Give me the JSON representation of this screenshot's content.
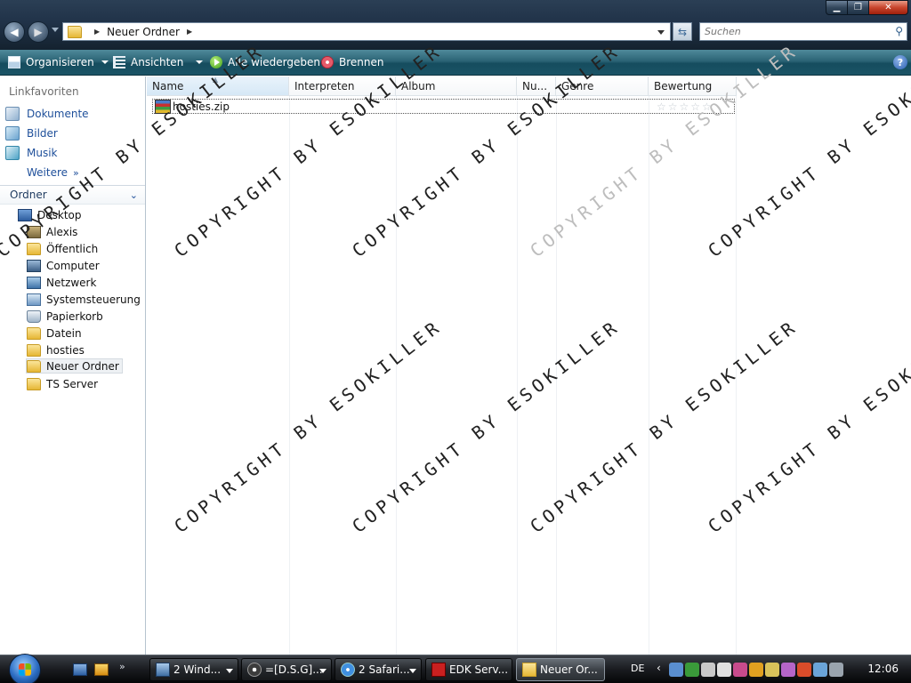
{
  "window": {
    "address_crumb": "Neuer Ordner",
    "search_placeholder": "Suchen"
  },
  "toolbar": {
    "organize": "Organisieren",
    "views": "Ansichten",
    "play_all": "Alle wiedergeben",
    "burn": "Brennen",
    "help_glyph": "?"
  },
  "nav": {
    "favorites_heading": "Linkfavoriten",
    "favorites": [
      {
        "label": "Dokumente",
        "icon": "documents-icon"
      },
      {
        "label": "Bilder",
        "icon": "pictures-icon"
      },
      {
        "label": "Musik",
        "icon": "music-icon"
      }
    ],
    "more_label": "Weitere",
    "folders_heading": "Ordner",
    "tree": [
      {
        "label": "Desktop",
        "icon": "desktop-icon"
      },
      {
        "label": "Alexis",
        "icon": "user-folder-icon"
      },
      {
        "label": "Öffentlich",
        "icon": "folder-icon"
      },
      {
        "label": "Computer",
        "icon": "computer-icon"
      },
      {
        "label": "Netzwerk",
        "icon": "network-icon"
      },
      {
        "label": "Systemsteuerung",
        "icon": "control-panel-icon"
      },
      {
        "label": "Papierkorb",
        "icon": "recycle-bin-icon"
      },
      {
        "label": "Datein",
        "icon": "folder-icon"
      },
      {
        "label": "hosties",
        "icon": "folder-icon"
      },
      {
        "label": "Neuer Ordner",
        "icon": "folder-icon",
        "selected": true
      },
      {
        "label": "TS Server",
        "icon": "folder-icon"
      }
    ]
  },
  "list": {
    "columns": [
      "Name",
      "Interpreten",
      "Album",
      "Nu...",
      "Genre",
      "Bewertung"
    ],
    "files": [
      {
        "name": "hosties.zip",
        "icon": "zip-archive-icon",
        "rating": 0
      }
    ]
  },
  "watermark": "COPYRIGHT BY ESOKILLER",
  "taskbar": {
    "buttons": [
      {
        "label": "2 Wind...",
        "icon": "windows-explorer-icon"
      },
      {
        "label": "=[D.S.G]...",
        "icon": "steam-icon"
      },
      {
        "label": "2 Safari...",
        "icon": "safari-icon"
      },
      {
        "label": "EDK Serv...",
        "icon": "filezilla-icon"
      },
      {
        "label": "Neuer Or...",
        "icon": "folder-icon"
      }
    ],
    "language": "DE",
    "clock": "12:06"
  },
  "colors": {
    "command_bar": "#1b5466",
    "link_blue": "#1e4f9a",
    "taskbar": "#1a1c20"
  }
}
